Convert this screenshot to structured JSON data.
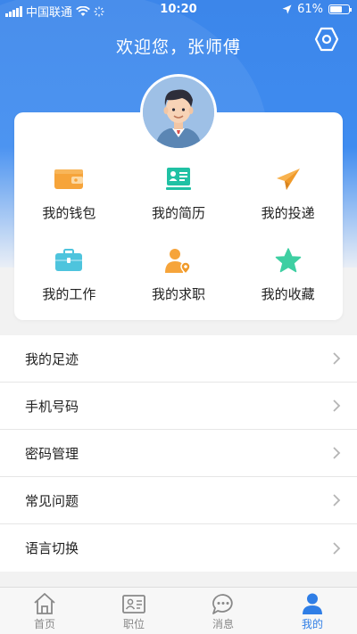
{
  "status_bar": {
    "carrier": "中国联通",
    "time": "10:20",
    "battery": "61%"
  },
  "header": {
    "welcome": "欢迎您，张师傅",
    "settings_icon": "settings-hexagon-icon"
  },
  "colors": {
    "primary": "#3c86ea",
    "wallet": "#f6a43a",
    "resume": "#20c1a4",
    "send": "#f6a43a",
    "work": "#4ec4dd",
    "search": "#f6a43a",
    "favorite": "#3ecfa2",
    "tab_active": "#2f7ee6",
    "tab_inactive": "#888888"
  },
  "grid": [
    {
      "label": "我的钱包",
      "icon": "wallet-icon"
    },
    {
      "label": "我的简历",
      "icon": "resume-icon"
    },
    {
      "label": "我的投递",
      "icon": "paper-plane-icon"
    },
    {
      "label": "我的工作",
      "icon": "briefcase-icon"
    },
    {
      "label": "我的求职",
      "icon": "person-location-icon"
    },
    {
      "label": "我的收藏",
      "icon": "star-icon"
    }
  ],
  "list": [
    {
      "label": "我的足迹"
    },
    {
      "label": "手机号码"
    },
    {
      "label": "密码管理"
    },
    {
      "label": "常见问题"
    },
    {
      "label": "语言切换"
    }
  ],
  "tabs": [
    {
      "label": "首页",
      "icon": "home-icon",
      "active": false
    },
    {
      "label": "职位",
      "icon": "id-card-icon",
      "active": false
    },
    {
      "label": "消息",
      "icon": "chat-bubble-icon",
      "active": false
    },
    {
      "label": "我的",
      "icon": "person-icon",
      "active": true
    }
  ]
}
